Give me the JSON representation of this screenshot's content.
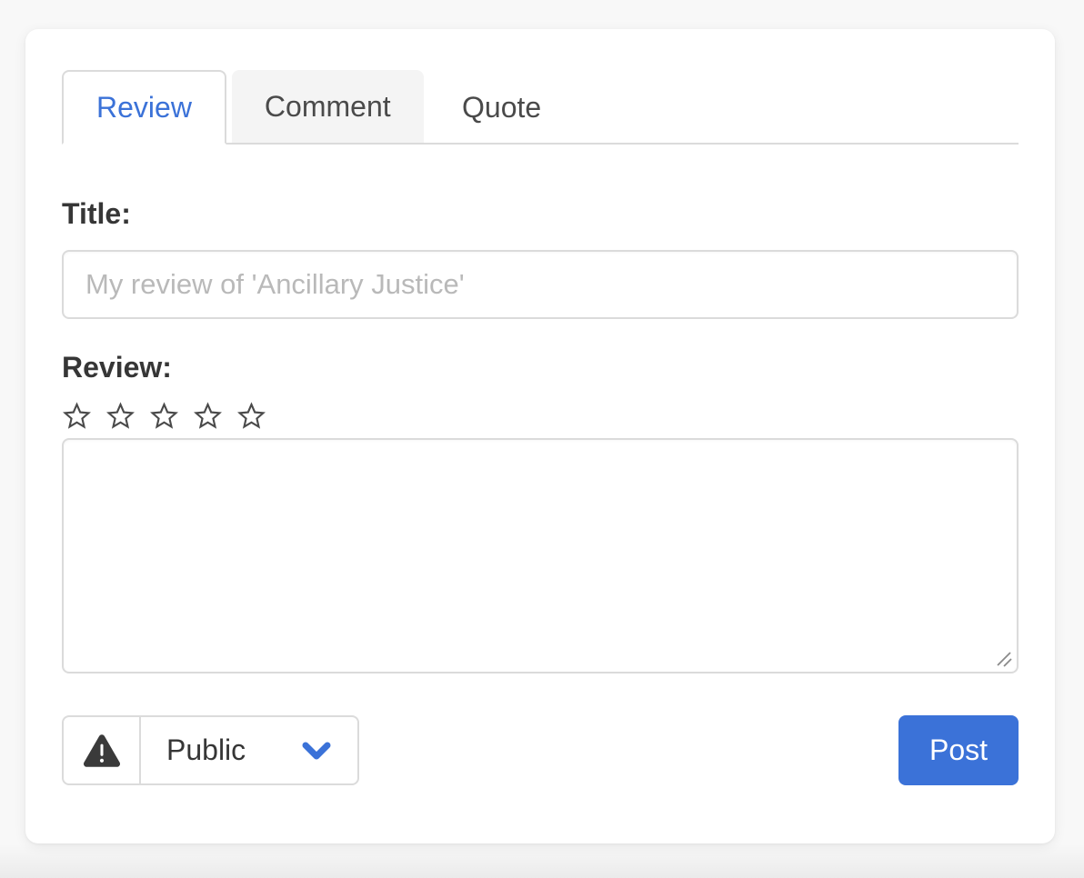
{
  "colors": {
    "accent": "#3b72d8",
    "ink": "#363636",
    "tab-ink": "#4a4a4a",
    "border": "#dbdbdb",
    "placeholder": "#b9b9b9",
    "hover-bg": "#f4f4f4",
    "page-bg": "#f8f8f8",
    "card-bg": "#ffffff",
    "star": "#4a4a4a"
  },
  "tabs": {
    "items": [
      {
        "label": "Review",
        "state": "active"
      },
      {
        "label": "Comment",
        "state": "hovered"
      },
      {
        "label": "Quote",
        "state": "normal"
      }
    ]
  },
  "form": {
    "title_label": "Title:",
    "title_value": "",
    "title_placeholder": "My review of 'Ancillary Justice'",
    "review_label": "Review:",
    "review_value": "",
    "rating": {
      "value": 0,
      "max": 5
    },
    "privacy": {
      "selected": "Public"
    },
    "post_label": "Post"
  },
  "icons": {
    "warning": "warning-triangle-icon",
    "privacy_chevron": "chevron-down-icon",
    "rating_star": "star-outline-icon",
    "resize": "resize-grip-icon"
  }
}
